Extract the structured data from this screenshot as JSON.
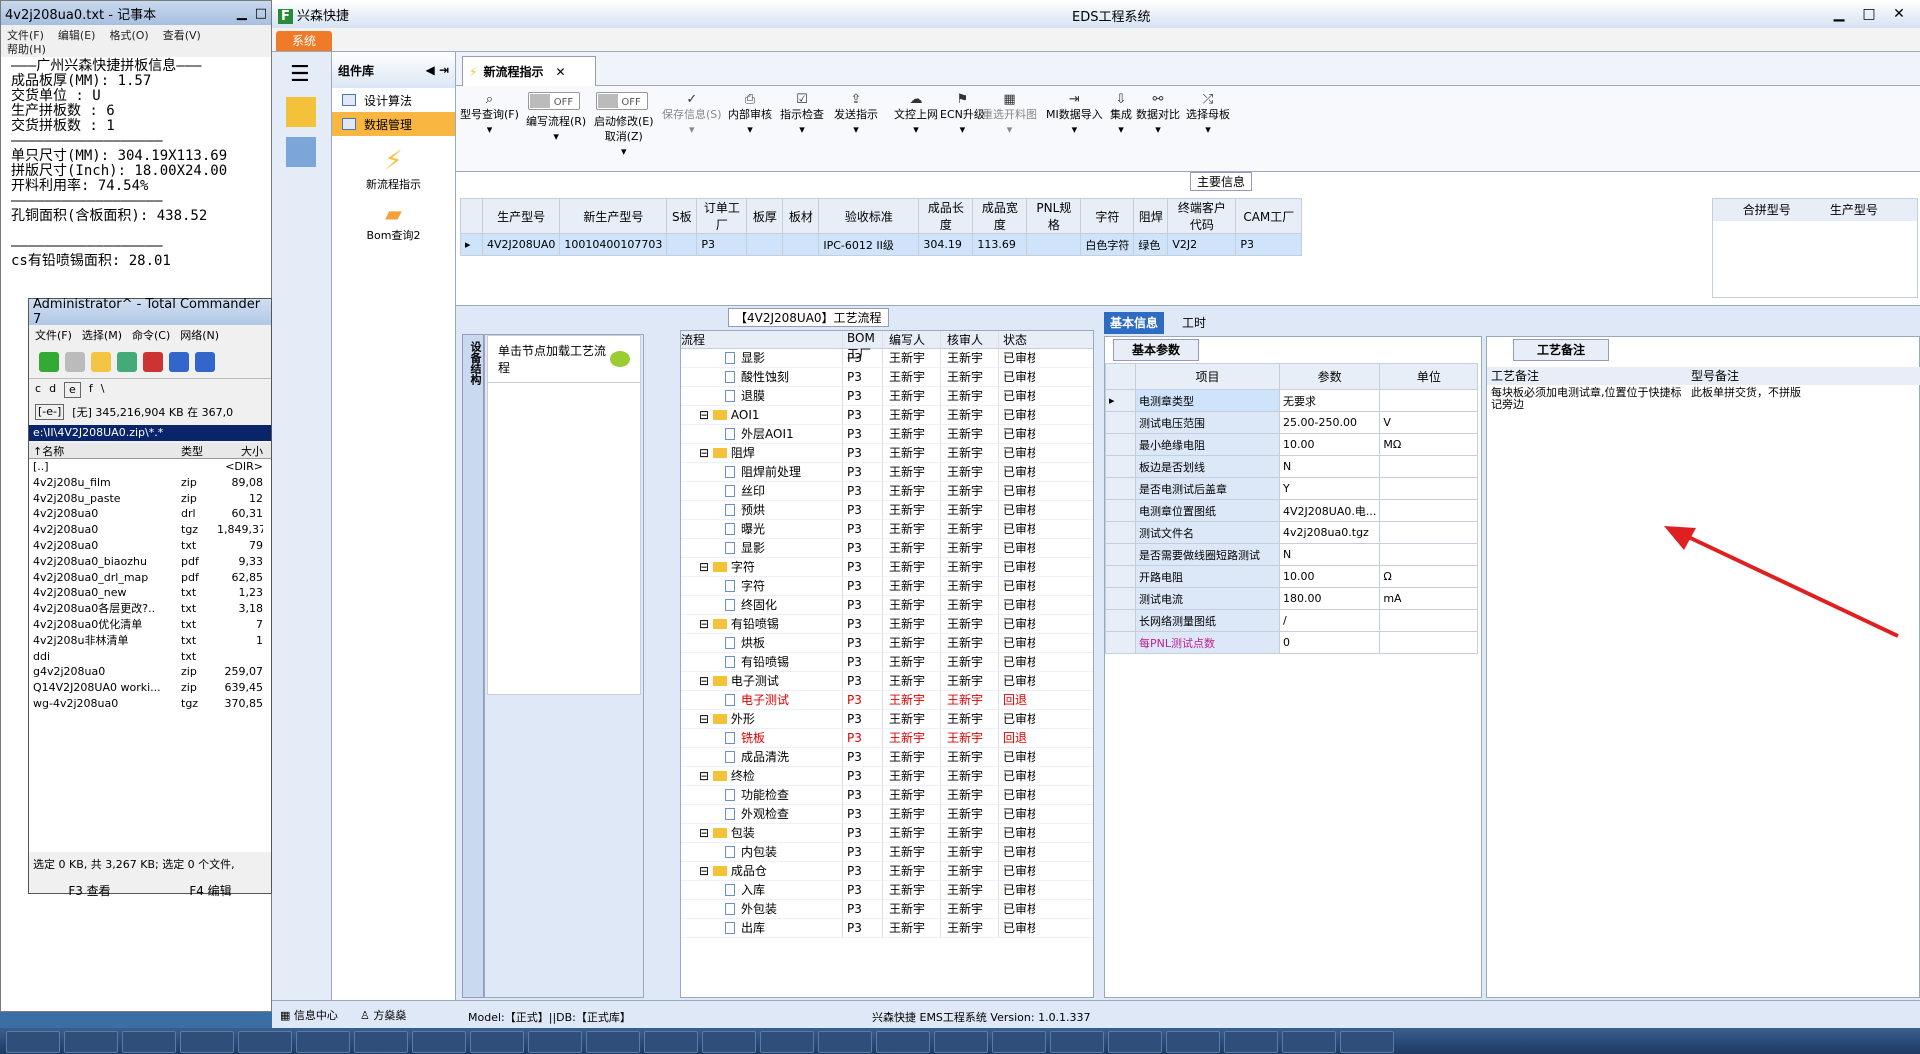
{
  "notepad": {
    "title": "4v2j208ua0.txt - 记事本",
    "menu": [
      "文件(F)",
      "编辑(E)",
      "格式(O)",
      "查看(V)",
      "帮助(H)"
    ],
    "lines": [
      "———广州兴森快捷拼板信息———",
      "成品板厚(MM): 1.57",
      "交货单位 : U",
      "生产拼板数 : 6",
      "交货拼板数 : 1",
      "——————————————————",
      "单只尺寸(MM): 304.19X113.69",
      "拼版尺寸(Inch): 18.00X24.00",
      "开料利用率: 74.54%",
      "——————————————————",
      "孔铜面积(含板面积): 438.52",
      "",
      "——————————————————",
      "cs有铅喷锡面积: 28.01"
    ]
  },
  "tc": {
    "title": "Administrator^ - Total Commander 7",
    "menu": [
      "文件(F)",
      "选择(M)",
      "命令(C)",
      "网络(N)"
    ],
    "drives": [
      "c",
      "d",
      "e",
      "f",
      "\\"
    ],
    "drive_sel": "[-e-]",
    "free": "[无]  345,216,904 KB 在 367,0",
    "path": "e:\\II\\4V2J208UA0.zip\\*.*",
    "headers": [
      "↑名称",
      "类型",
      "大小"
    ],
    "files": [
      [
        "[..]",
        "",
        "<DIR>"
      ],
      [
        "4v2j208u_film",
        "zip",
        "89,08"
      ],
      [
        "4v2j208u_paste",
        "zip",
        "12"
      ],
      [
        "4v2j208ua0",
        "drl",
        "60,31"
      ],
      [
        "4v2j208ua0",
        "tgz",
        "1,849,37"
      ],
      [
        "4v2j208ua0",
        "txt",
        "79"
      ],
      [
        "4v2j208ua0_biaozhu",
        "pdf",
        "9,33"
      ],
      [
        "4v2j208ua0_drl_map",
        "pdf",
        "62,85"
      ],
      [
        "4v2j208ua0_new",
        "txt",
        "1,23"
      ],
      [
        "4v2j208ua0各层更改?..",
        "txt",
        "3,18"
      ],
      [
        "4v2j208ua0优化清单",
        "txt",
        "7"
      ],
      [
        "4v2j208u非林清单",
        "txt",
        "1"
      ],
      [
        "ddi",
        "txt",
        ""
      ],
      [
        "g4v2j208ua0",
        "zip",
        "259,07"
      ],
      [
        "Q14V2J208UA0 worki...",
        "zip",
        "639,45"
      ],
      [
        "wg-4v2j208ua0",
        "tgz",
        "370,85"
      ]
    ],
    "status": "选定 0 KB, 共 3,267 KB; 选定 0 个文件,",
    "f3": "F3 查看",
    "f4": "F4 编辑"
  },
  "eds": {
    "app_title": "兴森快捷",
    "window_title": "EDS工程系统",
    "sys": "系统",
    "lib_title": "组件库",
    "lib_items": [
      "设计算法",
      "数据管理"
    ],
    "lib_big": [
      "新流程指示",
      "Bom查询2"
    ],
    "tab": "新流程指示",
    "toolbar": [
      {
        "l": "型号查询(F)",
        "g": "⌕"
      },
      {
        "l": "编写流程(R)",
        "t": "OFF"
      },
      {
        "l": "启动修改(E)\n取消(Z)",
        "t": "OFF"
      },
      {
        "l": "保存信息(S)",
        "g": "✓",
        "d": true
      },
      {
        "l": "内部审核",
        "g": "⎙"
      },
      {
        "l": "指示检查",
        "g": "☑"
      },
      {
        "l": "发送指示",
        "g": "⇪"
      },
      {
        "l": "文控上网",
        "g": "☁"
      },
      {
        "l": "ECN升级",
        "g": "⚑"
      },
      {
        "l": "重选开料图",
        "g": "▦",
        "d": true
      },
      {
        "l": "MI数据导入",
        "g": "⇥"
      },
      {
        "l": "集成",
        "g": "⇩"
      },
      {
        "l": "数据对比",
        "g": "⚯"
      },
      {
        "l": "选择母板",
        "g": "⤮"
      }
    ],
    "main_info": "主要信息",
    "main_headers": [
      "生产型号",
      "新生产型号",
      "S板",
      "订单工厂",
      "板厚",
      "板材",
      "验收标准",
      "成品长度",
      "成品宽度",
      "PNL规格",
      "字符",
      "阻焊",
      "终端客户代码",
      "CAM工厂"
    ],
    "main_row": [
      "4V2J208UA0",
      "10010400107703",
      "",
      "P3",
      "",
      "",
      "IPC-6012 II级",
      "304.19",
      "113.69",
      "",
      "白色字符",
      "绿色",
      "V2J2",
      "P3"
    ],
    "hebing_headers": [
      "合拼型号",
      "生产型号"
    ],
    "flow_title": "【4V2J208UA0】工艺流程",
    "side_tab": "设备结构",
    "click_hint": "单击节点加载工艺流程",
    "flow_headers": [
      "流程",
      "BOM工厂",
      "编写人",
      "核审人",
      "状态"
    ],
    "flow_rows": [
      [
        2,
        "显影",
        "P3",
        "王新宇",
        "王新宇",
        "已审核",
        0
      ],
      [
        2,
        "酸性蚀刻",
        "P3",
        "王新宇",
        "王新宇",
        "已审核",
        0
      ],
      [
        2,
        "退膜",
        "P3",
        "王新宇",
        "王新宇",
        "已审核",
        0
      ],
      [
        1,
        "AOI1",
        "P3",
        "王新宇",
        "王新宇",
        "已审核",
        0
      ],
      [
        2,
        "外层AOI1",
        "P3",
        "王新宇",
        "王新宇",
        "已审核",
        0
      ],
      [
        1,
        "阻焊",
        "P3",
        "王新宇",
        "王新宇",
        "已审核",
        0
      ],
      [
        2,
        "阻焊前处理",
        "P3",
        "王新宇",
        "王新宇",
        "已审核",
        0
      ],
      [
        2,
        "丝印",
        "P3",
        "王新宇",
        "王新宇",
        "已审核",
        0
      ],
      [
        2,
        "预烘",
        "P3",
        "王新宇",
        "王新宇",
        "已审核",
        0
      ],
      [
        2,
        "曝光",
        "P3",
        "王新宇",
        "王新宇",
        "已审核",
        0
      ],
      [
        2,
        "显影",
        "P3",
        "王新宇",
        "王新宇",
        "已审核",
        0
      ],
      [
        1,
        "字符",
        "P3",
        "王新宇",
        "王新宇",
        "已审核",
        0
      ],
      [
        2,
        "字符",
        "P3",
        "王新宇",
        "王新宇",
        "已审核",
        0
      ],
      [
        2,
        "终固化",
        "P3",
        "王新宇",
        "王新宇",
        "已审核",
        0
      ],
      [
        1,
        "有铅喷锡",
        "P3",
        "王新宇",
        "王新宇",
        "已审核",
        0
      ],
      [
        2,
        "烘板",
        "P3",
        "王新宇",
        "王新宇",
        "已审核",
        0
      ],
      [
        2,
        "有铅喷锡",
        "P3",
        "王新宇",
        "王新宇",
        "已审核",
        0
      ],
      [
        1,
        "电子测试",
        "P3",
        "王新宇",
        "王新宇",
        "已审核",
        0
      ],
      [
        2,
        "电子测试",
        "P3",
        "王新宇",
        "王新宇",
        "回退",
        1
      ],
      [
        1,
        "外形",
        "P3",
        "王新宇",
        "王新宇",
        "已审核",
        0
      ],
      [
        2,
        "铣板",
        "P3",
        "王新宇",
        "王新宇",
        "回退",
        1
      ],
      [
        2,
        "成品清洗",
        "P3",
        "王新宇",
        "王新宇",
        "已审核",
        0
      ],
      [
        1,
        "终检",
        "P3",
        "王新宇",
        "王新宇",
        "已审核",
        0
      ],
      [
        2,
        "功能检查",
        "P3",
        "王新宇",
        "王新宇",
        "已审核",
        0
      ],
      [
        2,
        "外观检查",
        "P3",
        "王新宇",
        "王新宇",
        "已审核",
        0
      ],
      [
        1,
        "包装",
        "P3",
        "王新宇",
        "王新宇",
        "已审核",
        0
      ],
      [
        2,
        "内包装",
        "P3",
        "王新宇",
        "王新宇",
        "已审核",
        0
      ],
      [
        1,
        "成品仓",
        "P3",
        "王新宇",
        "王新宇",
        "已审核",
        0
      ],
      [
        2,
        "入库",
        "P3",
        "王新宇",
        "王新宇",
        "已审核",
        0
      ],
      [
        2,
        "外包装",
        "P3",
        "王新宇",
        "王新宇",
        "已审核",
        0
      ],
      [
        2,
        "出库",
        "P3",
        "王新宇",
        "王新宇",
        "已审核",
        0
      ]
    ],
    "info_tabs": [
      "基本信息",
      "工时"
    ],
    "param_tab": "基本参数",
    "param_headers": [
      "项目",
      "参数",
      "单位"
    ],
    "params": [
      [
        "电测章类型",
        "无要求",
        ""
      ],
      [
        "测试电压范围",
        "25.00-250.00",
        "V"
      ],
      [
        "最小绝缘电阻",
        "10.00",
        "MΩ"
      ],
      [
        "板边是否划线",
        "N",
        ""
      ],
      [
        "是否电测试后盖章",
        "Y",
        ""
      ],
      [
        "电测章位置图纸",
        "4V2J208UA0.电...",
        ""
      ],
      [
        "测试文件名",
        "4v2j208ua0.tgz",
        ""
      ],
      [
        "是否需要做线圈短路测试",
        "N",
        ""
      ],
      [
        "开路电阻",
        "10.00",
        "Ω"
      ],
      [
        "测试电流",
        "180.00",
        "mA"
      ],
      [
        "长网络测量图纸",
        "/",
        ""
      ],
      [
        "每PNL测试点数",
        "0",
        ""
      ]
    ],
    "remark_tab": "工艺备注",
    "remark_headers": [
      "工艺备注",
      "型号备注"
    ],
    "remark1": "每块板必须加电测试章,位置位于快捷标记旁边",
    "remark2": "此板单拼交货，不拼版",
    "status": {
      "info": "信息中心",
      "user": "方燊燊",
      "model": "Model:【正式】||DB:【正式库】",
      "version": "兴森快捷 EMS工程系统 Version: 1.0.1.337"
    }
  },
  "colors": {
    "accent": "#ef7a27",
    "select": "#cfe3fb",
    "red": "#d00"
  }
}
